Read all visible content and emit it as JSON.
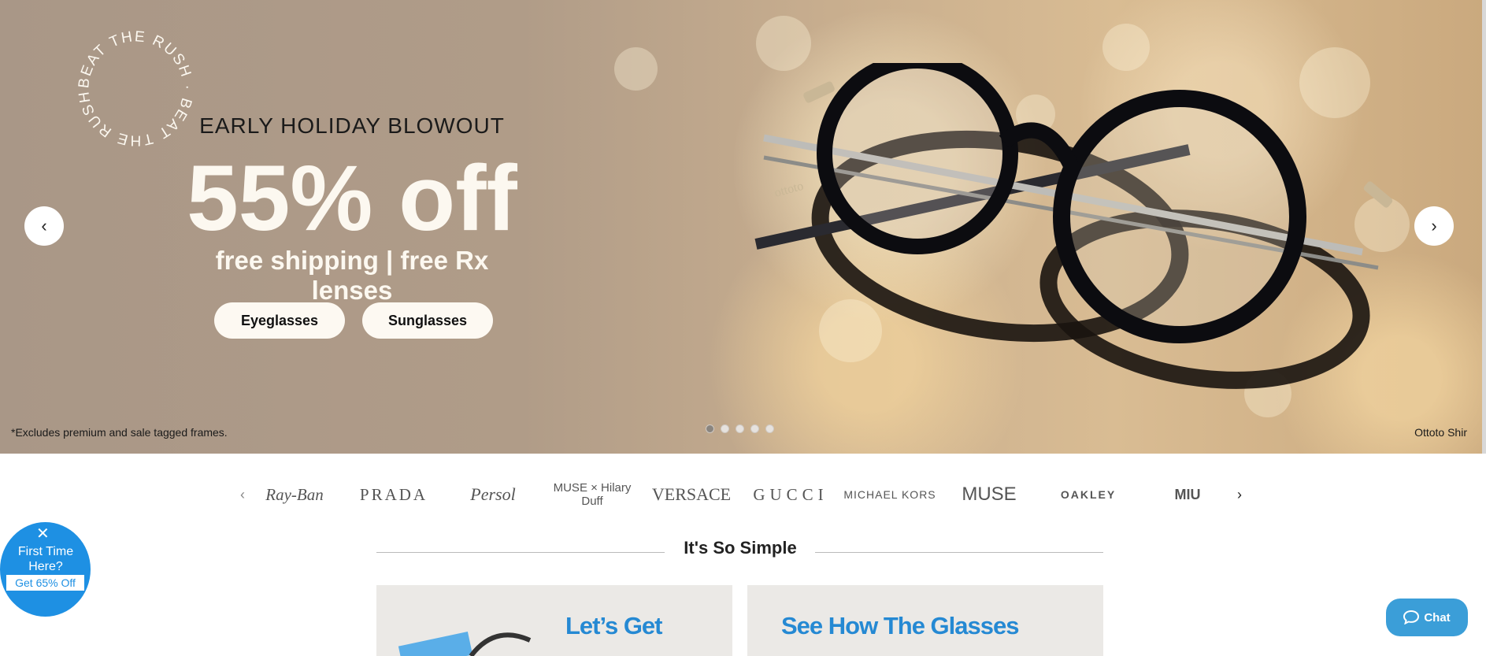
{
  "hero": {
    "badge_text": "BEAT THE RUSH · BEAT THE RUSH ·",
    "headline": "EARLY HOLIDAY BLOWOUT",
    "percent": "55% off",
    "subline": "free shipping | free Rx lenses",
    "buttons": {
      "eyeglasses": "Eyeglasses",
      "sunglasses": "Sunglasses"
    },
    "disclaimer": "*Excludes premium and sale tagged frames.",
    "credit": "Ottoto Shir",
    "prev_arrow": "‹",
    "next_arrow": "›",
    "slides_total": 5,
    "slide_active": 1,
    "frame_lettering": "ottoto"
  },
  "brands": {
    "prev_arrow": "‹",
    "next_arrow": "›",
    "items": [
      "Ray-Ban",
      "PRADA",
      "Persol",
      "MUSE × Hilary Duff",
      "VERSACE",
      "GUCCI",
      "MICHAEL KORS",
      "MUSE",
      "OAKLEY",
      "MIU"
    ]
  },
  "simple": {
    "title": "It's So Simple",
    "cards": [
      "Let’s Get",
      "See How The Glasses"
    ]
  },
  "promo": {
    "close": "✕",
    "text": "First Time Here?",
    "cta": "Get 65% Off"
  },
  "chat": {
    "label": "Chat"
  },
  "colors": {
    "accent_blue": "#1e90e3",
    "card_title": "#2589d3",
    "hero_text": "#fcf8f0"
  }
}
